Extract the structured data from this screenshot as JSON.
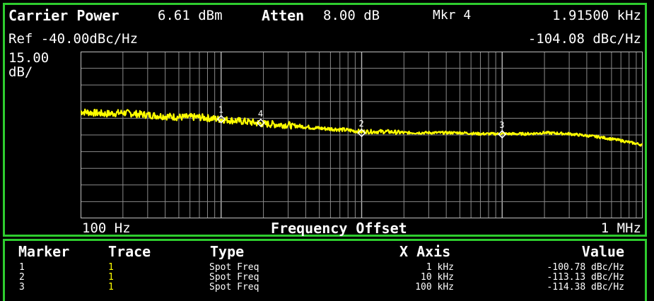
{
  "header": {
    "carrier_label": "Carrier Power",
    "carrier_value": "6.61 dBm",
    "atten_label": "Atten",
    "atten_value": "8.00 dB",
    "marker_label": "Mkr 4",
    "marker_x": "1.91500 kHz",
    "ref_label": "Ref -40.00dBc/Hz",
    "marker_y": "-104.08 dBc/Hz",
    "scale_value": "15.00",
    "scale_unit": "dB/"
  },
  "axis": {
    "x_start": "100 Hz",
    "x_title": "Frequency Offset",
    "x_end": "1 MHz"
  },
  "chart_data": {
    "type": "line",
    "x_scale": "log",
    "xlim": [
      100,
      1000000
    ],
    "ylim": [
      -190,
      -40
    ],
    "y_unit": "dBc/Hz",
    "grid": true,
    "trace_color": "#ffff00",
    "trace": {
      "x": [
        100,
        150,
        200,
        300,
        500,
        700,
        1000,
        1500,
        2000,
        3000,
        5000,
        7000,
        10000,
        15000,
        20000,
        30000,
        50000,
        70000,
        100000,
        150000,
        200000,
        300000,
        500000,
        700000,
        1000000
      ],
      "y": [
        -94,
        -96,
        -95,
        -97,
        -99,
        -99,
        -101,
        -103,
        -105,
        -106,
        -109,
        -110,
        -112,
        -112,
        -113,
        -113,
        -113,
        -114,
        -114,
        -114,
        -113,
        -114,
        -117,
        -120,
        -124
      ]
    },
    "markers": [
      {
        "label": "1",
        "x": 1000,
        "y": -100.78
      },
      {
        "label": "4",
        "x": 1915,
        "y": -104.08
      },
      {
        "label": "2",
        "x": 10000,
        "y": -113.13
      },
      {
        "label": "3",
        "x": 100000,
        "y": -114.38
      }
    ]
  },
  "table": {
    "headers": [
      "Marker",
      "Trace",
      "Type",
      "X Axis",
      "Value"
    ],
    "rows": [
      {
        "marker": "1",
        "trace": "1",
        "type": "Spot Freq",
        "x": "1 kHz",
        "value": "-100.78 dBc/Hz"
      },
      {
        "marker": "2",
        "trace": "1",
        "type": "Spot Freq",
        "x": "10 kHz",
        "value": "-113.13 dBc/Hz"
      },
      {
        "marker": "3",
        "trace": "1",
        "type": "Spot Freq",
        "x": "100 kHz",
        "value": "-114.38 dBc/Hz"
      }
    ]
  }
}
